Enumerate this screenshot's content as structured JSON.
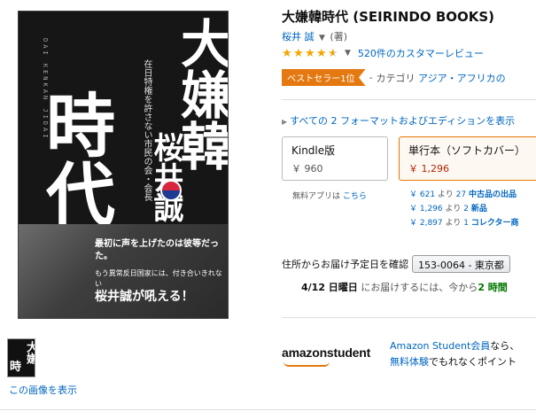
{
  "cover": {
    "romaji": "DAI KENKAN JIDAI",
    "title_top": "大嫌韓",
    "title_left": "時代",
    "subtitle": "在日特権を許さない市民の会・会長",
    "author": "桜井誠",
    "band_line1": "最初に声を上げたのは彼等だった。",
    "band_line2": "もう異常反日国家には、付き合いきれない",
    "band_line3": "桜井誠が吼える！"
  },
  "thumbnail": {
    "t1": "大嫌",
    "t2": "時",
    "view_image": "この画像を表示"
  },
  "product": {
    "title": "大嫌韓時代 (SEIRINDO BOOKS)",
    "author": "桜井 誠",
    "role": "(著)",
    "rating": 4.5,
    "reviews": "520件のカスタマーレビュー",
    "bestseller_badge": "ベストセラー1位",
    "bestseller_sep": "-",
    "bestseller_cat": "カテゴリ",
    "bestseller_cat_link": "アジア・アフリカの"
  },
  "formats": {
    "link": "すべての 2 フォーマットおよびエディションを表示",
    "kindle": {
      "name": "Kindle版",
      "price": "￥ 960"
    },
    "paperback": {
      "name": "単行本（ソフトカバー）",
      "price": "￥ 1,296"
    },
    "free_app": "無料アプリは",
    "free_app_link": "こちら"
  },
  "offers": [
    {
      "price": "￥ 621",
      "yori": "より",
      "count": "27",
      "cond": "中古品の出品"
    },
    {
      "price": "￥ 1,296",
      "yori": "より",
      "count": "2",
      "cond": "新品"
    },
    {
      "price": "￥ 2,897",
      "yori": "より",
      "count": "1",
      "cond": "コレクター商"
    }
  ],
  "shipping": {
    "label": "住所からお届け予定日を確認",
    "zip": "153-0064 - 東京都",
    "date": "4/12 日曜日",
    "mid": "にお届けするには、今から",
    "hours": "2 時間"
  },
  "student": {
    "logo": "amazonstudent",
    "line1_link": "Amazon Student会員",
    "line1_rest": "なら、",
    "line2_link": "無料体験",
    "line2_rest": "でもれなくポイント"
  },
  "colors": {
    "link": "#0066c0",
    "price": "#b12704",
    "badge": "#e47911",
    "star": "#f4a600",
    "green": "#007600"
  }
}
